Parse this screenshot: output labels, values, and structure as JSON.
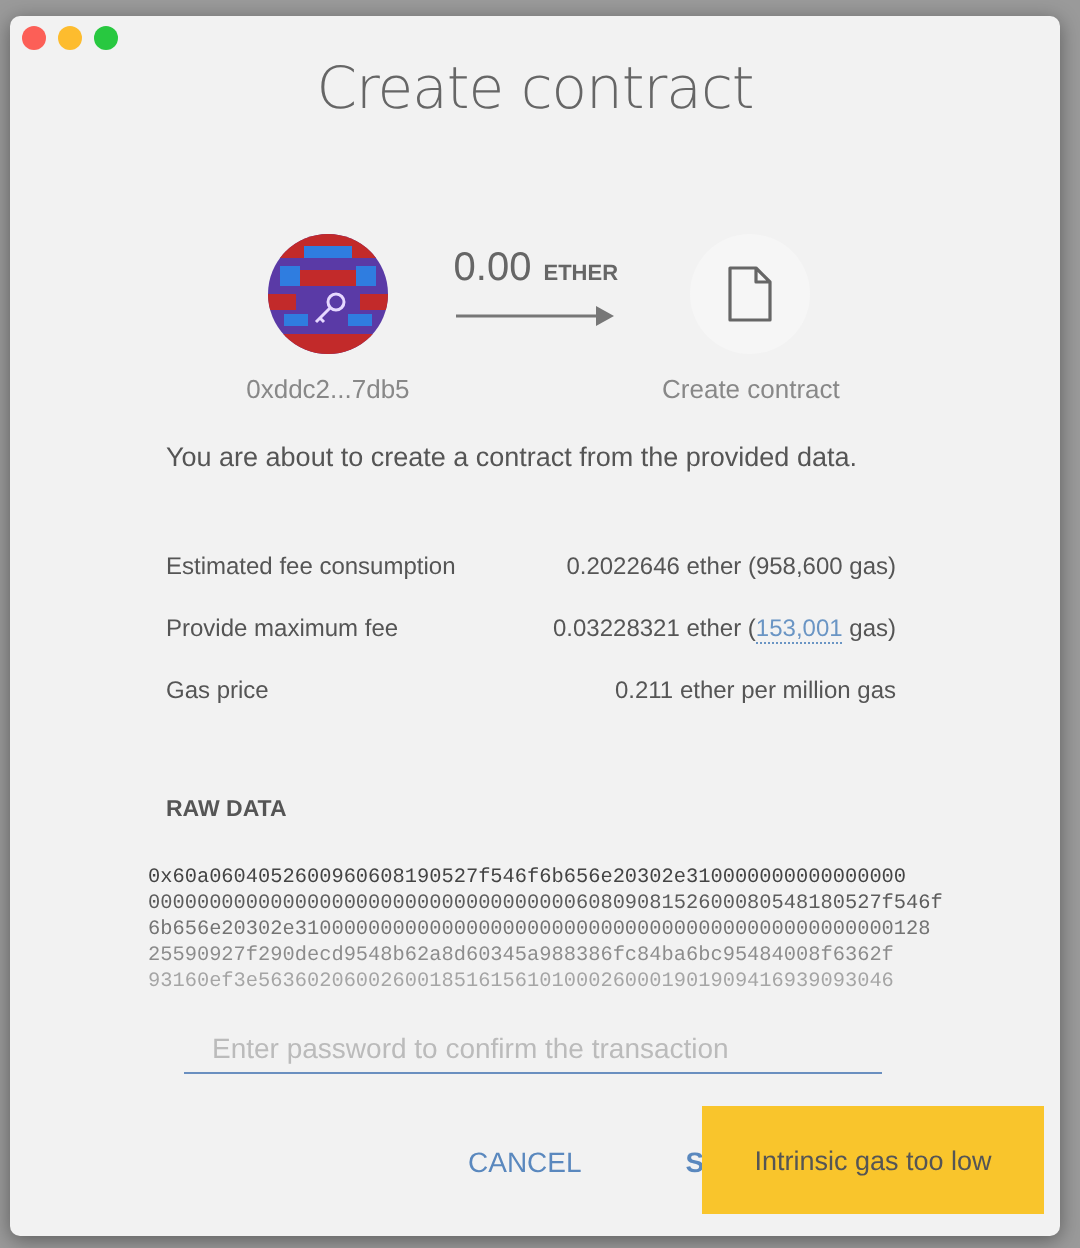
{
  "window": {
    "title": "Create contract"
  },
  "transfer": {
    "from": "0xddc2...7db5",
    "amount": "0.00",
    "unit": "ETHER",
    "to": "Create contract"
  },
  "description": "You are about to create a contract from the provided data.",
  "fees": [
    {
      "label": "Estimated fee consumption",
      "value": "0.2022646 ether (958,600 gas)"
    },
    {
      "label": "Provide maximum fee",
      "value_before": "0.03228321 ether (",
      "link": "153,001",
      "value_after": " gas)"
    },
    {
      "label": "Gas price",
      "value": "0.211 ether per million gas"
    }
  ],
  "raw_data": {
    "heading": "RAW DATA",
    "lines": [
      "0x60a0604052600960608190527f546f6b656e20302e310000000000000000",
      "000000000000000000000000000000000006080908152600080548180527f546f",
      "6b656e20302e3100000000000000000000000000000000000000000000000128",
      "25590927f290decd9548b62a8d60345a988386fc84ba6bc95484008f6362f",
      "93160ef3e5636020600260018516156101000260001901909416939093046"
    ]
  },
  "password": {
    "placeholder": "Enter password to confirm the transaction"
  },
  "buttons": [
    {
      "label": "CANCEL",
      "kind": "cancel"
    },
    {
      "label": "S",
      "kind": "send"
    }
  ],
  "toast": {
    "message": "Intrinsic gas too low"
  }
}
